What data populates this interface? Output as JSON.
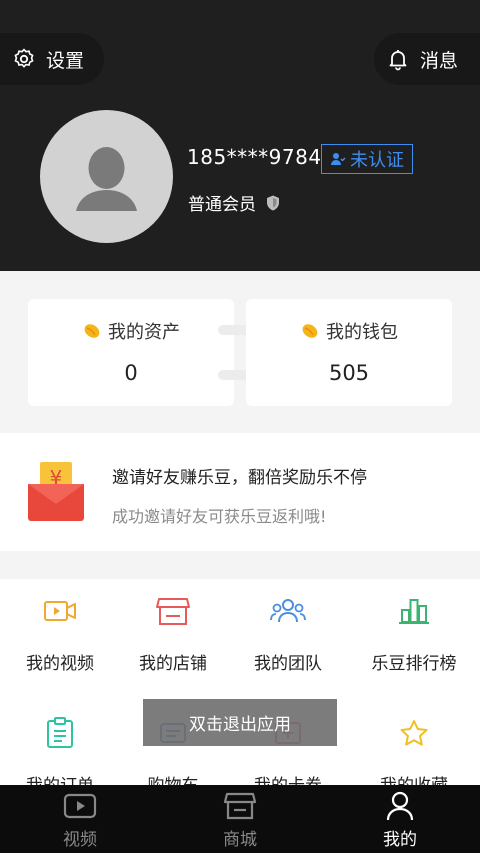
{
  "header": {
    "settings_label": "设置",
    "messages_label": "消息",
    "phone": "185****9784",
    "verify_label": "未认证",
    "member_level": "普通会员"
  },
  "assets": {
    "my_assets_label": "我的资产",
    "my_assets_value": "0",
    "my_wallet_label": "我的钱包",
    "my_wallet_value": "505"
  },
  "invite": {
    "title": "邀请好友赚乐豆，翻倍奖励乐不停",
    "subtitle": "成功邀请好友可获乐豆返利哦!",
    "envelope_symbol": "¥"
  },
  "grid": {
    "items": [
      {
        "label": "我的视频",
        "icon": "video-icon",
        "color": "#f0a830"
      },
      {
        "label": "我的店铺",
        "icon": "store-icon",
        "color": "#e85a5a"
      },
      {
        "label": "我的团队",
        "icon": "team-icon",
        "color": "#4a8fe0"
      },
      {
        "label": "乐豆排行榜",
        "icon": "ranking-icon",
        "color": "#3cb371"
      },
      {
        "label": "我的订单",
        "icon": "order-icon",
        "color": "#2ec4a0"
      },
      {
        "label": "购物车",
        "icon": "cart-icon",
        "color": "#4a6fd0"
      },
      {
        "label": "我的卡券",
        "icon": "coupon-icon",
        "color": "#e85a5a"
      },
      {
        "label": "我的收藏",
        "icon": "star-icon",
        "color": "#f0c020"
      }
    ]
  },
  "toast": "双击退出应用",
  "tabs": [
    {
      "label": "视频",
      "icon": "video-tab-icon"
    },
    {
      "label": "商城",
      "icon": "mall-tab-icon"
    },
    {
      "label": "我的",
      "icon": "profile-tab-icon",
      "active": true
    }
  ],
  "colors": {
    "header_bg": "#1f1f1f",
    "accent_blue": "#3d8ef0",
    "tabbar_bg": "#0c0c0c"
  }
}
